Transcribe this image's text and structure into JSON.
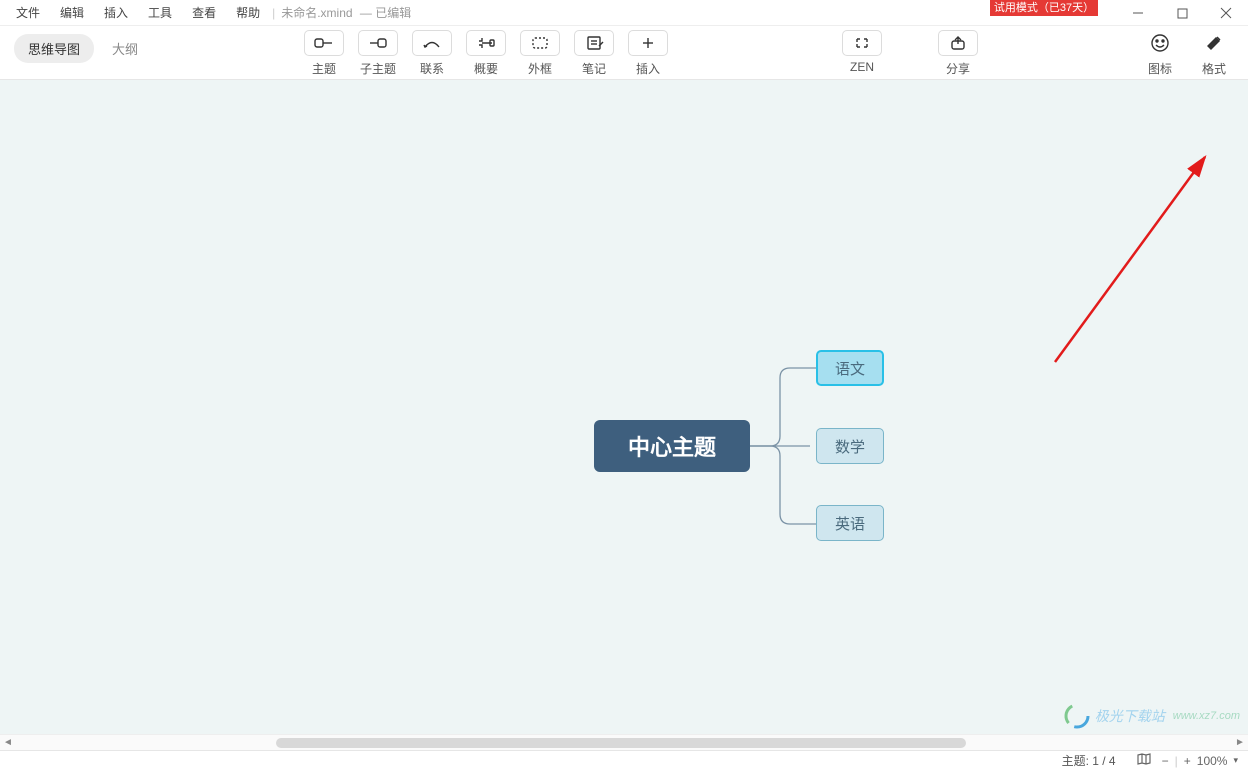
{
  "menubar": {
    "items": [
      "文件",
      "编辑",
      "插入",
      "工具",
      "查看",
      "帮助"
    ],
    "filename": "未命名.xmind",
    "edit_status": "已编辑"
  },
  "trial_badge": "试用模式（已37天）",
  "window_controls": {
    "minimize": "minimize",
    "maximize": "maximize",
    "close": "close"
  },
  "view_switch": {
    "mindmap": "思维导图",
    "outline": "大纲"
  },
  "toolbar": {
    "topic": "主题",
    "subtopic": "子主题",
    "relationship": "联系",
    "summary": "概要",
    "boundary": "外框",
    "notes": "笔记",
    "insert": "插入",
    "zen": "ZEN",
    "share": "分享",
    "iconset": "图标",
    "format": "格式"
  },
  "mindmap": {
    "central": "中心主题",
    "children": [
      "语文",
      "数学",
      "英语"
    ],
    "selected_index": 0
  },
  "statusbar": {
    "topic_label": "主题: 1 / 4",
    "zoom": "100%"
  },
  "watermark": {
    "main": "极光下载站",
    "sub": "www.xz7.com"
  }
}
